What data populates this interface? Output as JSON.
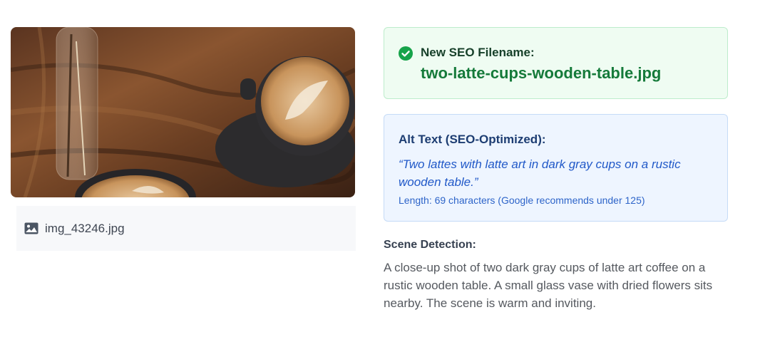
{
  "image_preview": {
    "description_icon": "image-icon",
    "filename": "img_43246.jpg"
  },
  "seo_filename": {
    "icon": "check-circle-icon",
    "label": "New SEO Filename:",
    "value": "two-latte-cups-wooden-table.jpg",
    "accent": "#157a3a"
  },
  "alt_text": {
    "label": "Alt Text (SEO-Optimized):",
    "text": "“Two lattes with latte art in dark gray cups on a rustic wooden table.”",
    "length_note": "Length: 69 characters (Google recommends under 125)",
    "accent": "#2159c8"
  },
  "scene_detection": {
    "label": "Scene Detection:",
    "text": "A close-up shot of two dark gray cups of latte art coffee on a rustic wooden table. A small glass vase with dried flowers sits nearby. The scene is warm and inviting."
  }
}
